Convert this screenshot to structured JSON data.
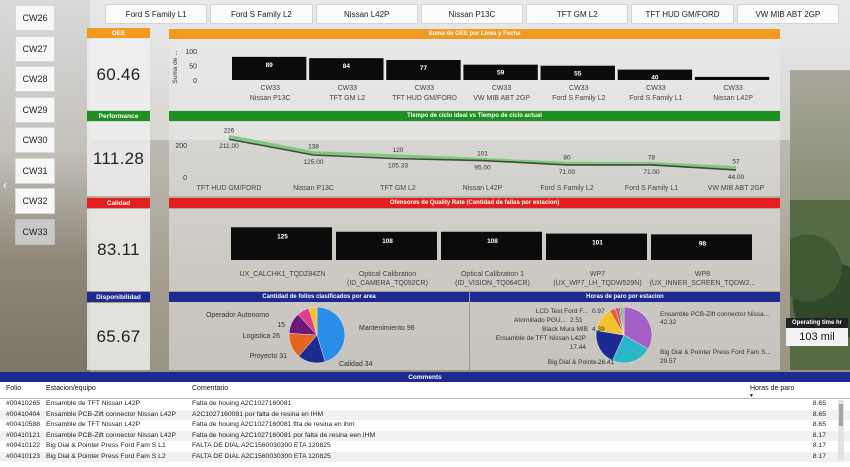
{
  "weeks": [
    "CW26",
    "CW27",
    "CW28",
    "CW29",
    "CW30",
    "CW31",
    "CW32",
    "CW33"
  ],
  "selected_week": "CW33",
  "slicers": [
    "Ford S Family L1",
    "Ford S Family L2",
    "Nissan L42P",
    "Nissan P13C",
    "TFT GM L2",
    "TFT HUD GM/FORD",
    "VW MIB ABT 2GP"
  ],
  "kpis": {
    "oee": {
      "label": "OEE",
      "value": "60.46",
      "color": "#f39a1e"
    },
    "performance": {
      "label": "Performance",
      "value": "111.28",
      "color": "#1f8f22"
    },
    "calidad": {
      "label": "Calidad",
      "value": "83.11",
      "color": "#e21e1e"
    },
    "disponibilidad": {
      "label": "Disponibilidad",
      "value": "65.67",
      "color": "#1d2a8f"
    }
  },
  "sections": {
    "oee_chart": {
      "title": "Suma de OEE por Linea y Fecha",
      "color": "#f39a1e"
    },
    "cycle_chart": {
      "title": "Tiempo de ciclo ideal vs Tiempo de ciclo actual",
      "color": "#1f8f22"
    },
    "quality_chart": {
      "title": "Ofensores de Quality Rate (Cantidad de fallas por estacion)",
      "color": "#e21e1e"
    },
    "folios_chart": {
      "title": "Cantidad de folios clasificados por area",
      "color": "#1d2a8f"
    },
    "paro_chart": {
      "title": "Horas de paro por estacion",
      "color": "#1d2a8f"
    }
  },
  "chart_data": [
    {
      "type": "bar",
      "title": "Suma de OEE por Linea y Fecha",
      "ylabel": "Suma de ...",
      "ylim": [
        0,
        100
      ],
      "yticks": [
        "100",
        "50",
        "0"
      ],
      "categories": [
        "CW33 Nissan P13C",
        "CW33 TFT GM L2",
        "CW33 TFT HUD GM/FORD",
        "CW33 VW MIB ABT 2GP",
        "CW33 Ford S Family L2",
        "CW33 Ford S Family L1",
        "CW33 Nissan L42P"
      ],
      "cat_top": [
        "CW33",
        "CW33",
        "CW33",
        "CW33",
        "CW33",
        "CW33",
        "CW33"
      ],
      "cat_bottom": [
        "Nissan P13C",
        "TFT GM L2",
        "TFT HUD GM/FORD",
        "VW MIB ABT 2GP",
        "Ford S Family L2",
        "Ford S Family L1",
        "Nissan L42P"
      ],
      "values": [
        89,
        84,
        77,
        59,
        55,
        40,
        12
      ],
      "labels": [
        "89",
        "84",
        "77",
        "59",
        "55",
        "40",
        ""
      ]
    },
    {
      "type": "line",
      "title": "Tiempo de ciclo ideal vs Tiempo de ciclo actual",
      "yticks": [
        "200",
        "0"
      ],
      "ylim": [
        0,
        250
      ],
      "categories": [
        "TFT HUD GM/FORD",
        "Nissan P13C",
        "TFT GM L2",
        "Nissan L42P",
        "Ford S Family L2",
        "Ford S Family L1",
        "VW MIB ABT 2GP"
      ],
      "series": [
        {
          "values": [
            226,
            138,
            120,
            101,
            80,
            78,
            57
          ],
          "labels": [
            "226",
            "138",
            "120",
            "101",
            "80",
            "78",
            "57"
          ],
          "color": "#7fc97a"
        },
        {
          "values": [
            211,
            125,
            105.33,
            95,
            71,
            71,
            44
          ],
          "labels": [
            "211.00",
            "125.00",
            "105.33",
            "95.00",
            "71.00",
            "71.00",
            "44.00"
          ],
          "color": "#3d4a3d"
        }
      ]
    },
    {
      "type": "bar",
      "title": "Ofensores de Quality Rate (Cantidad de fallas por estacion)",
      "categories": [
        "UX_CALCHK1_TQDZ84ZN",
        "Optical Calibration (ID_CAMERA_TQ092CR)",
        "Optical Calibration 1 (ID_VISION_TQ064CR)",
        "WP7 (UX_WP7_LH_TQDW529N)",
        "WP8 (UX_INNER_SCREEN_TQDW2..."
      ],
      "cat_top": [
        "UX_CALCHK1_TQDZ84ZN",
        "Optical Calibration",
        "Optical Calibration 1",
        "WP7",
        "WP8"
      ],
      "cat_bottom": [
        "",
        "(ID_CAMERA_TQ092CR)",
        "(ID_VISION_TQ064CR)",
        "(UX_WP7_LH_TQDW529N)",
        "(UX_INNER_SCREEN_TQDW2..."
      ],
      "values": [
        125,
        108,
        108,
        101,
        98
      ],
      "labels": [
        "125",
        "108",
        "108",
        "101",
        "98"
      ]
    },
    {
      "type": "pie",
      "title": "Cantidad de folios clasificados por area",
      "slices": [
        {
          "name": "Mantenimiento",
          "value": 96,
          "label": "Mantenimiento 96",
          "color": "#2a8de8"
        },
        {
          "name": "Calidad",
          "value": 34,
          "label": "Calidad 34",
          "color": "#1d2a8f"
        },
        {
          "name": "Proyecto",
          "value": 31,
          "label": "Proyecto 31",
          "color": "#e2661f"
        },
        {
          "name": "Logistica",
          "value": 26,
          "label": "Logistica 26",
          "color": "#6b1a7a"
        },
        {
          "name": "Operador Autonomo",
          "value": 15,
          "label": "15",
          "color": "#e23d8b"
        },
        {
          "name": "Otros",
          "value": 10,
          "label": "",
          "color": "#f2c12e"
        }
      ],
      "side_label": "Operador Autonomo"
    },
    {
      "type": "pie",
      "title": "Horas de paro por estacion",
      "slices": [
        {
          "name": "Ensamble PCB-Zift connector Nissan...",
          "value": 42.32,
          "label1": "Ensamble PCB-Zift connector Nissa...",
          "label2": "42.32",
          "color": "#a560c8"
        },
        {
          "name": "Big Dial & Pointer Press Ford Fam S...",
          "value": 29.57,
          "label1": "Big Dial & Pointer Press Ford Fam S...",
          "label2": "29.57",
          "color": "#2ab6c6"
        },
        {
          "name": "Big Dial & Pointe...",
          "value": 26.41,
          "label1": "Big Dial & Pointe...",
          "label2": "26.41",
          "color": "#1d2a8f"
        },
        {
          "name": "Ensamble de TFT Nissan L42P",
          "value": 17.44,
          "label1": "Ensamble de TFT Nissan L42P",
          "label2": "17.44",
          "color": "#f2c12e"
        },
        {
          "name": "Black Mura MIB",
          "value": 4.39,
          "label1": "Black Mura MIB",
          "label2": "4.39",
          "color": "#e2661f"
        },
        {
          "name": "Atornillado PGU...",
          "value": 2.51,
          "label1": "Atornillado PGU...",
          "label2": "2.51",
          "color": "#e23d8b"
        },
        {
          "name": "LCD Test Ford F...",
          "value": 0.97,
          "label1": "LCD Test Ford F...",
          "label2": "0.97",
          "color": "#6b1a7a"
        },
        {
          "name": "Otros",
          "value": 3,
          "label1": "",
          "label2": "",
          "color": "#7fc97a"
        }
      ]
    }
  ],
  "operating_time": {
    "label": "Operating time hr",
    "value": "103 mil"
  },
  "comments": {
    "title": "Comments",
    "headers": [
      "Folio",
      "Estacion/equipo",
      "Comentario",
      "Horas de paro"
    ],
    "rows": [
      [
        "#00410265",
        "Ensamble de TFT Nissan L42P",
        "Falta de houing A2C1027160081",
        "8.65"
      ],
      [
        "#00410404",
        "Ensamble PCB-Zift connector Nissan L42P",
        "A2C1027160081 por falta de resina en IHM",
        "8.65"
      ],
      [
        "#00410588",
        "Ensamble de TFT Nissan L42P",
        "Falta de houing A2C1027160081 flta de resina en ihm",
        "8.65"
      ],
      [
        "#00410121",
        "Ensamble PCB-Zift connector Nissan L42P",
        "Falta de houing A2C1027160081 por falta de resina een IHM",
        "8.17"
      ],
      [
        "#00410122",
        "Big Dial & Pointer Press Ford Fam S L1",
        "FALTA DE DIAL A2C1560030300 ETA 120825",
        "8.17"
      ],
      [
        "#00410123",
        "Big Dial & Pointer Press Ford Fam S L2",
        "FALTA DE DIAL A2C1560030300 ETA 120825",
        "8.17"
      ]
    ]
  }
}
